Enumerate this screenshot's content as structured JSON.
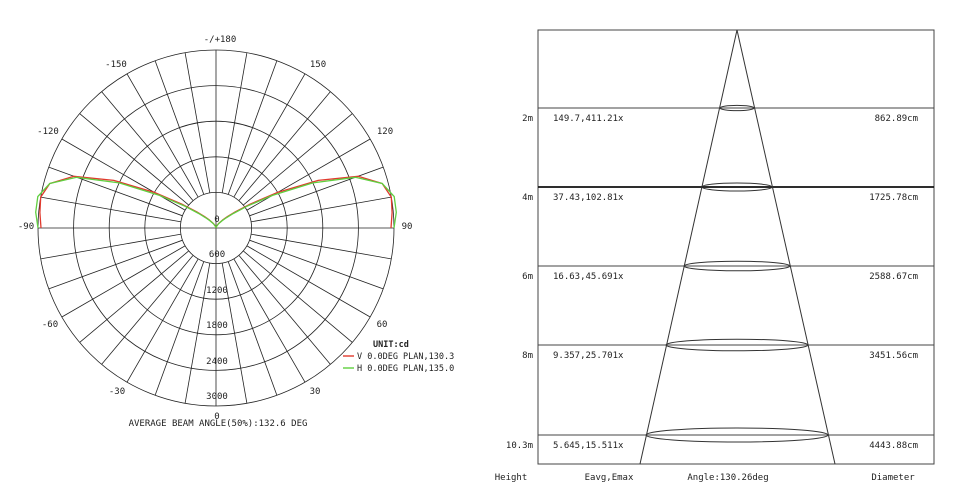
{
  "polar": {
    "unit_label": "UNIT:cd",
    "beam_text": "AVERAGE BEAM ANGLE(50%):132.6 DEG",
    "angle_labels": [
      "-/+180",
      "150",
      "-150",
      "120",
      "-120",
      "90",
      "-90",
      "60",
      "-60",
      "30",
      "-30",
      "0"
    ],
    "radial_labels": [
      "0",
      "600",
      "1200",
      "1800",
      "2400",
      "3000"
    ],
    "legend": [
      {
        "label": "V 0.0DEG PLAN,130.3",
        "color": "#e03a2e"
      },
      {
        "label": "H 0.0DEG PLAN,135.0",
        "color": "#5fcf3f"
      }
    ]
  },
  "cone": {
    "rows": [
      {
        "height": "2m",
        "eavg_emax": "149.7,411.21x",
        "diameter": "862.89cm"
      },
      {
        "height": "4m",
        "eavg_emax": "37.43,102.81x",
        "diameter": "1725.78cm"
      },
      {
        "height": "6m",
        "eavg_emax": "16.63,45.691x",
        "diameter": "2588.67cm"
      },
      {
        "height": "8m",
        "eavg_emax": "9.357,25.701x",
        "diameter": "3451.56cm"
      },
      {
        "height": "10.3m",
        "eavg_emax": "5.645,15.511x",
        "diameter": "4443.88cm"
      }
    ],
    "footer": {
      "height": "Height",
      "eavg": "Eavg,Emax",
      "angle": "Angle:130.26deg",
      "diameter": "Diameter"
    }
  },
  "chart_data": {
    "type": "polar",
    "unit": "cd",
    "r_max": 3000,
    "series": [
      {
        "name": "V 0.0DEG PLAN,130.3",
        "angles_deg": [
          180,
          170,
          160,
          150,
          140,
          135,
          130,
          125,
          120,
          115,
          110,
          105,
          100,
          95,
          90
        ],
        "values": [
          0,
          10,
          40,
          90,
          180,
          270,
          420,
          700,
          1200,
          1900,
          2550,
          2900,
          3000,
          2980,
          2950
        ]
      },
      {
        "name": "H 0.0DEG PLAN,135.0",
        "angles_deg": [
          180,
          170,
          160,
          150,
          140,
          135,
          130,
          125,
          120,
          115,
          110,
          105,
          100,
          95,
          90
        ],
        "values": [
          0,
          10,
          30,
          80,
          160,
          240,
          380,
          640,
          1100,
          1800,
          2500,
          2900,
          3050,
          3050,
          3000
        ]
      }
    ]
  }
}
